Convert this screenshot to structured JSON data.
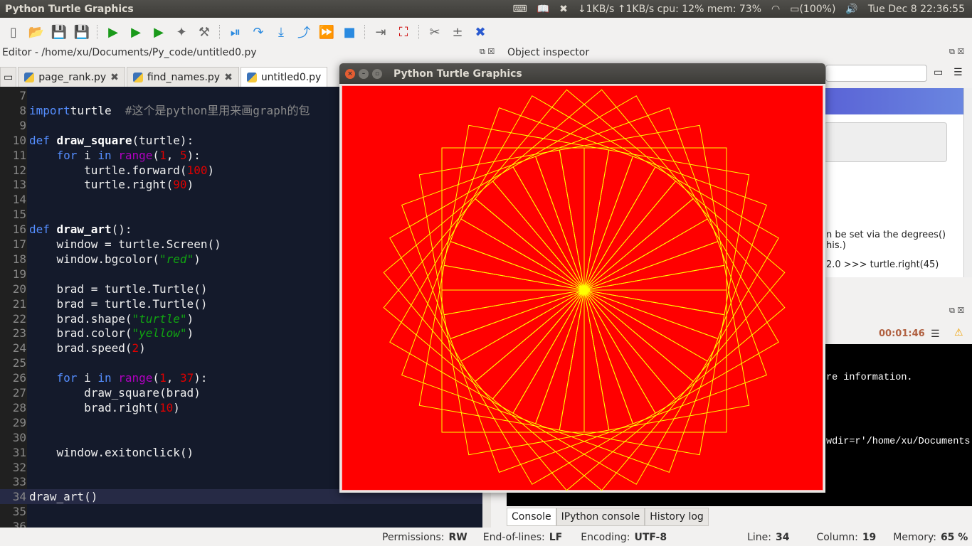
{
  "topbar": {
    "title": "Python Turtle Graphics",
    "net": "↓1KB/s ↑1KB/s cpu: 12% mem: 73%",
    "battery": "(100%)",
    "clock": "Tue Dec  8 22:36:55",
    "icons": [
      "keyboard-icon",
      "book-icon",
      "dropbox-icon",
      "wifi-icon",
      "battery-icon",
      "volume-icon"
    ]
  },
  "toolbar": {
    "icons": [
      "new-file-icon",
      "open-file-icon",
      "save-icon",
      "save-all-icon",
      "run-icon",
      "run-config-icon",
      "rerun-icon",
      "debug-icon",
      "run-settings-icon",
      "debug-continue-icon",
      "step-icon",
      "step-into-icon",
      "step-return-icon",
      "continue-icon",
      "stop-icon",
      "maximize-pane-icon",
      "fullscreen-icon",
      "preferences-icon",
      "pythonpath-icon",
      "spyder-icon"
    ]
  },
  "editor": {
    "title": "Editor - /home/xu/Documents/Py_code/untitled0.py",
    "tabs": [
      {
        "label": "page_rank.py"
      },
      {
        "label": "find_names.py"
      },
      {
        "label": "untitled0.py",
        "active": true
      }
    ],
    "current_line": 34,
    "lines": [
      {
        "n": "7",
        "tokens": []
      },
      {
        "n": "8",
        "tokens": [
          [
            "kw",
            "import"
          ],
          [
            "",
            "turtle  "
          ],
          [
            "cm",
            "#这个是python里用来画graph的包"
          ]
        ]
      },
      {
        "n": "9",
        "tokens": []
      },
      {
        "n": "10",
        "tokens": [
          [
            "kw",
            "def "
          ],
          [
            "fn",
            "draw_square"
          ],
          [
            "",
            "(turtle):"
          ]
        ]
      },
      {
        "n": "11",
        "tokens": [
          [
            "",
            "    "
          ],
          [
            "kw",
            "for"
          ],
          [
            "",
            " i "
          ],
          [
            "kw",
            "in"
          ],
          [
            "",
            " "
          ],
          [
            "bi",
            "range"
          ],
          [
            "",
            "("
          ],
          [
            "num",
            "1"
          ],
          [
            "",
            ", "
          ],
          [
            "num",
            "5"
          ],
          [
            "",
            "):"
          ]
        ]
      },
      {
        "n": "12",
        "tokens": [
          [
            "",
            "        turtle.forward("
          ],
          [
            "num",
            "100"
          ],
          [
            "",
            ")"
          ]
        ]
      },
      {
        "n": "13",
        "tokens": [
          [
            "",
            "        turtle.right("
          ],
          [
            "num",
            "90"
          ],
          [
            "",
            ")"
          ]
        ]
      },
      {
        "n": "14",
        "tokens": []
      },
      {
        "n": "15",
        "tokens": []
      },
      {
        "n": "16",
        "tokens": [
          [
            "kw",
            "def "
          ],
          [
            "fn",
            "draw_art"
          ],
          [
            "",
            "():"
          ]
        ]
      },
      {
        "n": "17",
        "tokens": [
          [
            "",
            "    window = turtle.Screen()"
          ]
        ]
      },
      {
        "n": "18",
        "tokens": [
          [
            "",
            "    window.bgcolor("
          ],
          [
            "str",
            "\"red\""
          ],
          [
            "",
            ")"
          ]
        ]
      },
      {
        "n": "19",
        "tokens": []
      },
      {
        "n": "20",
        "tokens": [
          [
            "",
            "    brad = turtle.Turtle()"
          ]
        ]
      },
      {
        "n": "21",
        "tokens": [
          [
            "",
            "    brad = turtle.Turtle()"
          ]
        ]
      },
      {
        "n": "22",
        "tokens": [
          [
            "",
            "    brad.shape("
          ],
          [
            "str",
            "\"turtle\""
          ],
          [
            "",
            ")"
          ]
        ]
      },
      {
        "n": "23",
        "tokens": [
          [
            "",
            "    brad.color("
          ],
          [
            "str",
            "\"yellow\""
          ],
          [
            "",
            ")"
          ]
        ]
      },
      {
        "n": "24",
        "tokens": [
          [
            "",
            "    brad.speed("
          ],
          [
            "num",
            "2"
          ],
          [
            "",
            ")"
          ]
        ]
      },
      {
        "n": "25",
        "tokens": []
      },
      {
        "n": "26",
        "tokens": [
          [
            "",
            "    "
          ],
          [
            "kw",
            "for"
          ],
          [
            "",
            " i "
          ],
          [
            "kw",
            "in"
          ],
          [
            "",
            " "
          ],
          [
            "bi",
            "range"
          ],
          [
            "",
            "("
          ],
          [
            "num",
            "1"
          ],
          [
            "",
            ", "
          ],
          [
            "num",
            "37"
          ],
          [
            "",
            "):"
          ]
        ]
      },
      {
        "n": "27",
        "tokens": [
          [
            "",
            "        draw_square(brad)"
          ]
        ]
      },
      {
        "n": "28",
        "tokens": [
          [
            "",
            "        brad.right("
          ],
          [
            "num",
            "10"
          ],
          [
            "",
            ")"
          ]
        ]
      },
      {
        "n": "29",
        "tokens": []
      },
      {
        "n": "30",
        "tokens": []
      },
      {
        "n": "31",
        "tokens": [
          [
            "",
            "    window.exitonclick()"
          ]
        ]
      },
      {
        "n": "32",
        "tokens": []
      },
      {
        "n": "33",
        "tokens": []
      },
      {
        "n": "34",
        "tokens": [
          [
            "",
            "draw_art()"
          ]
        ]
      },
      {
        "n": "35",
        "tokens": []
      },
      {
        "n": "36",
        "tokens": []
      }
    ]
  },
  "inspector": {
    "title": "Object inspector",
    "text1": "n be set via the degrees()",
    "text2": "his.)",
    "text3": "2.0 >>> turtle.right(45)"
  },
  "console": {
    "timer": "00:01:46",
    "line1": "re information.",
    "line2": "wdir=r'/home/xu/Documents",
    "tabs": [
      "Console",
      "IPython console",
      "History log"
    ]
  },
  "status": {
    "permissions_label": "Permissions:",
    "permissions": "RW",
    "eol_label": "End-of-lines:",
    "eol": "LF",
    "encoding_label": "Encoding:",
    "encoding": "UTF-8",
    "line_label": "Line:",
    "line": "34",
    "column_label": "Column:",
    "column": "19",
    "memory_label": "Memory:",
    "memory": "65 %"
  },
  "turtle_window": {
    "title": "Python Turtle Graphics",
    "bgcolor": "#ff0000",
    "pen_color": "#ffff00",
    "squares": 36,
    "side": 100,
    "turn": 10
  }
}
